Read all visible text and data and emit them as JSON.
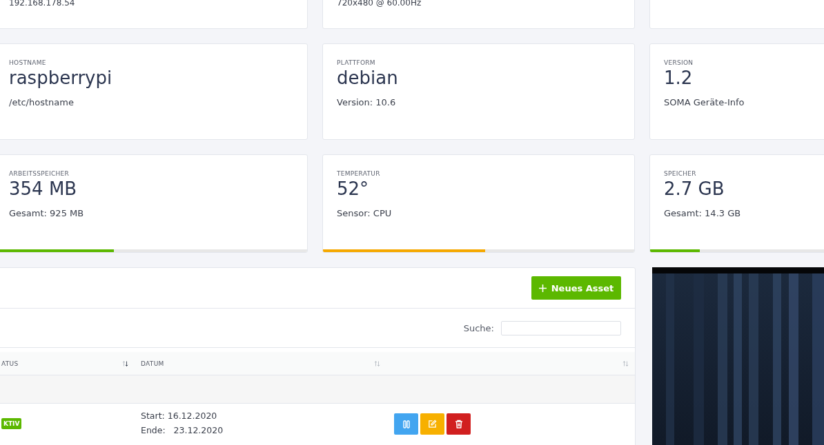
{
  "top_cards": [
    {
      "sub": "192.168.178.54"
    },
    {
      "sub": "720x480 @ 60.00Hz"
    }
  ],
  "info_cards": [
    {
      "label": "HOSTNAME",
      "value": "raspberrypi",
      "sub": "/etc/hostname"
    },
    {
      "label": "PLATTFORM",
      "value": "debian",
      "sub": "Version: 10.6"
    },
    {
      "label": "VERSION",
      "value": "1.2",
      "sub": "SOMA Geräte-Info"
    }
  ],
  "meter_cards": [
    {
      "label": "ARBEITSSPEICHER",
      "value": "354 MB",
      "sub": "Gesamt: 925 MB",
      "level": 0.38,
      "color": "#5cb800"
    },
    {
      "label": "TEMPERATUR",
      "value": "52°",
      "sub": "Sensor: CPU",
      "level": 0.52,
      "color": "#f5a800"
    },
    {
      "label": "SPEICHER",
      "value": "2.7 GB",
      "sub": "Gesamt: 14.3 GB",
      "level": 0.16,
      "color": "#5cb800"
    }
  ],
  "assets": {
    "new_button": "Neues Asset",
    "search_label": "Suche:",
    "columns": [
      {
        "label": "ATUS"
      },
      {
        "label": "DATUM"
      },
      {}
    ],
    "rows": [
      {
        "status": "KTIV",
        "start": "Start: 16.12.2020",
        "end": "Ende:",
        "end_date": "23.12.2020",
        "actions": [
          {
            "kind": "pause"
          },
          {
            "kind": "edit"
          },
          {
            "kind": "delete"
          }
        ]
      }
    ]
  }
}
